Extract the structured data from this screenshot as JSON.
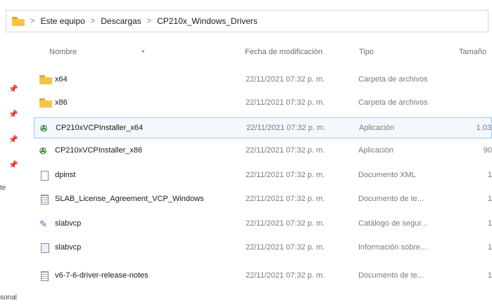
{
  "address_bar": {
    "crumbs": [
      "Este equipo",
      "Descargas",
      "CP210x_Windows_Drivers"
    ],
    "separator": ">"
  },
  "columns": {
    "name": "Nombre",
    "date": "Fecha de modificación",
    "type": "Tipo",
    "size": "Tamaño"
  },
  "left_fragments": [
    "sonal",
    "te"
  ],
  "rows": [
    {
      "name": "x64",
      "date": "22/11/2021 07:32 p. m.",
      "type": "Carpeta de archivos",
      "size": "",
      "icon": "folder-icon"
    },
    {
      "name": "x86",
      "date": "22/11/2021 07:32 p. m.",
      "type": "Carpeta de archivos",
      "size": "",
      "icon": "folder-icon"
    },
    {
      "name": "CP210xVCPInstaller_x64",
      "date": "22/11/2021 07:32 p. m.",
      "type": "Aplicación",
      "size": "1.03",
      "icon": "installer-icon",
      "selected": true
    },
    {
      "name": "CP210xVCPInstaller_x86",
      "date": "22/11/2021 07:32 p. m.",
      "type": "Aplicación",
      "size": "90",
      "icon": "installer-icon"
    },
    {
      "name": "dpinst",
      "date": "22/11/2021 07:32 p. m.",
      "type": "Documento XML",
      "size": "1",
      "icon": "document-icon"
    },
    {
      "name": "SLAB_License_Agreement_VCP_Windows",
      "date": "22/11/2021 07:32 p. m.",
      "type": "Documento de te...",
      "size": "1",
      "icon": "text-document-icon"
    },
    {
      "name": "slabvcp",
      "date": "22/11/2021 07:32 p. m.",
      "type": "Catálogo de segur...",
      "size": "1",
      "icon": "catalog-icon"
    },
    {
      "name": "slabvcp",
      "date": "22/11/2021 07:32 p. m.",
      "type": "Información sobre...",
      "size": "1",
      "icon": "setup-info-icon"
    },
    {
      "name": "v6-7-6-driver-release-notes",
      "date": "22/11/2021 07:32 p. m.",
      "type": "Documento de te...",
      "size": "1",
      "icon": "text-document-icon"
    }
  ]
}
